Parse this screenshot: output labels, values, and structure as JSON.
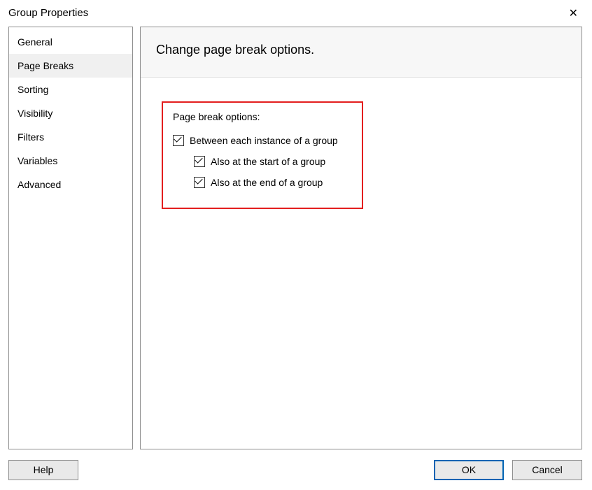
{
  "title": "Group Properties",
  "sidebar": {
    "items": [
      {
        "label": "General"
      },
      {
        "label": "Page Breaks"
      },
      {
        "label": "Sorting"
      },
      {
        "label": "Visibility"
      },
      {
        "label": "Filters"
      },
      {
        "label": "Variables"
      },
      {
        "label": "Advanced"
      }
    ]
  },
  "content": {
    "header": "Change page break options.",
    "options_label": "Page break options:",
    "checkboxes": [
      {
        "label": "Between each instance of a group"
      },
      {
        "label": "Also at the start of a group"
      },
      {
        "label": "Also at the end of a group"
      }
    ]
  },
  "buttons": {
    "help": "Help",
    "ok": "OK",
    "cancel": "Cancel"
  }
}
